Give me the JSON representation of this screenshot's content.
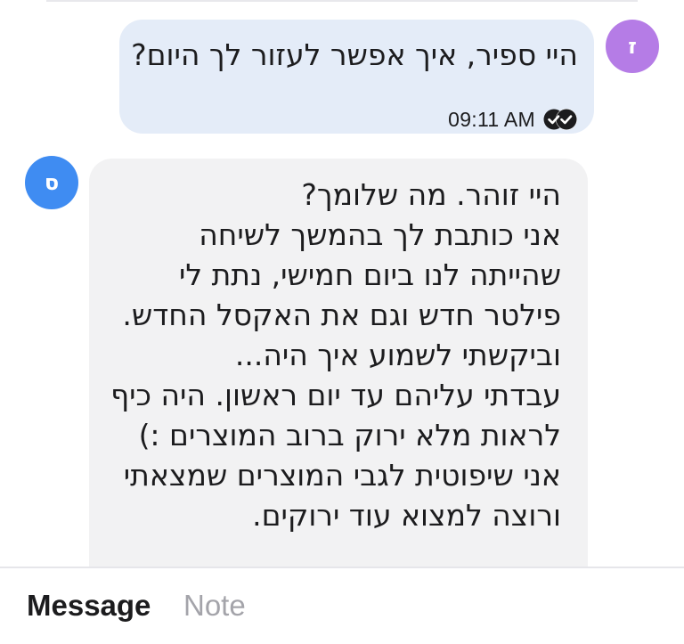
{
  "conversation": {
    "outgoing": {
      "avatar_letter": "ז",
      "avatar_color": "#b57ce6",
      "text": "היי ספיר, איך אפשר לעזור לך היום?",
      "time": "09:11 AM",
      "status_icon": "read-receipt-double-check-icon",
      "bubble_color": "#e4ecf8"
    },
    "incoming": {
      "avatar_letter": "ס",
      "avatar_color": "#3f8cf2",
      "bubble_color": "#f2f2f3",
      "lines": [
        "היי זוהר. מה שלומך?",
        "אני כותבת לך בהמשך לשיחה",
        "שהייתה לנו ביום חמישי, נתת לי",
        "פילטר חדש וגם את האקסל החדש.",
        "וביקשתי לשמוע איך היה...",
        "עבדתי עליהם עד יום ראשון. היה כיף",
        "לראות מלא ירוק ברוב המוצרים :)",
        "אני שיפוטית לגבי המוצרים שמצאתי",
        "ורוצה למצוא עוד ירוקים."
      ]
    }
  },
  "composer": {
    "tabs": [
      {
        "label": "Message",
        "active": true
      },
      {
        "label": "Note",
        "active": false
      }
    ]
  }
}
